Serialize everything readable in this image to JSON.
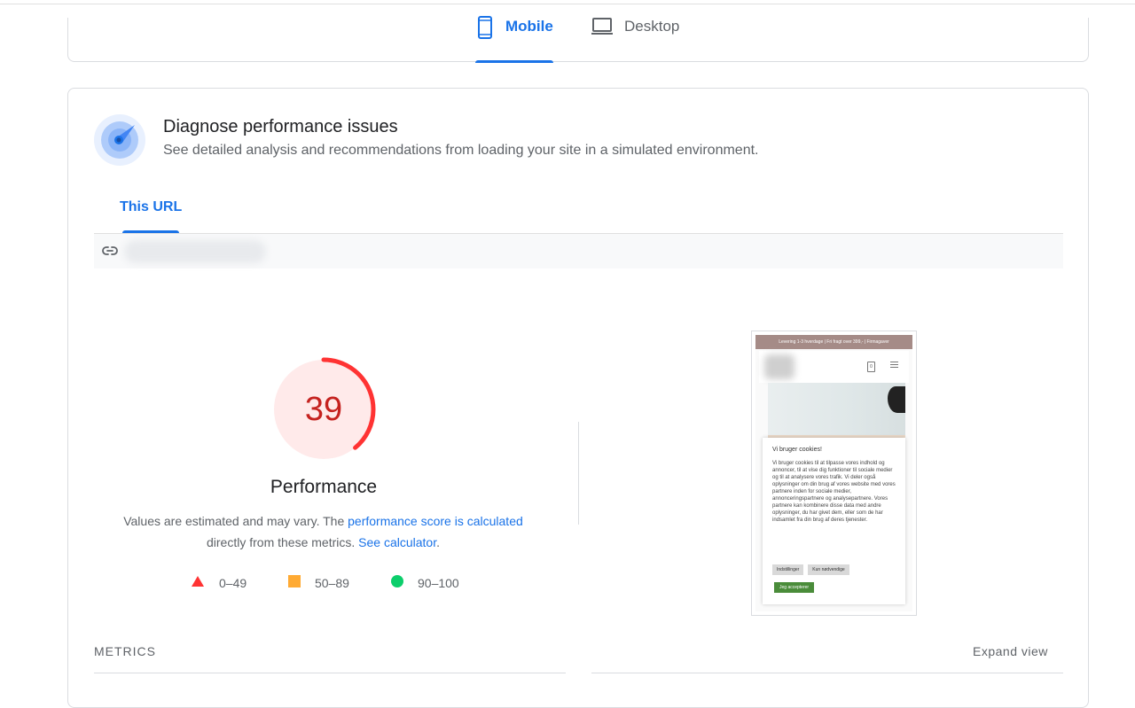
{
  "device_tabs": [
    {
      "label": "Mobile",
      "icon": "smartphone-icon",
      "selected": true
    },
    {
      "label": "Desktop",
      "icon": "laptop-icon",
      "selected": false
    }
  ],
  "diagnose": {
    "title": "Diagnose performance issues",
    "subtitle": "See detailed analysis and recommendations from loading your site in a simulated environment."
  },
  "url_tab": {
    "label": "This URL"
  },
  "score": {
    "value": "39",
    "fraction": 0.39,
    "label": "Performance",
    "desc_before": "Values are estimated and may vary. The ",
    "desc_link1": "performance score is calculated",
    "desc_middle": " directly from these metrics. ",
    "desc_link2": "See calculator",
    "desc_after": "."
  },
  "legend": [
    {
      "range": "0–49",
      "shape": "triangle",
      "color": "#ff3333"
    },
    {
      "range": "50–89",
      "shape": "square",
      "color": "#ffaa33"
    },
    {
      "range": "90–100",
      "shape": "circle",
      "color": "#0cce6b"
    }
  ],
  "screenshot": {
    "banner": "Levering 1-3 hverdage | Fri fragt over 399,- | Firmagaver",
    "bag_count": "0",
    "popup_title": "Vi bruger cookies!",
    "popup_body": "Vi bruger cookies til at tilpasse vores indhold og annoncer, til at vise dig funktioner til sociale medier og til at analysere vores trafik. Vi deler også oplysninger om din brug af vores website med vores partnere inden for sociale medier, annonceringspartnere og analysepartnere. Vores partnere kan kombinere disse data med andre oplysninger, du har givet dem, eller som de har indsamlet fra din brug af deres tjenester.",
    "btn_settings": "Indstillinger",
    "btn_necessary": "Kun nødvendige",
    "btn_accept": "Jeg accepterer"
  },
  "metrics": {
    "label": "METRICS",
    "expand": "Expand view"
  },
  "colors": {
    "accent": "#1a73e8",
    "fail": "#ff3333",
    "fail_text": "#c5221f",
    "fail_bg": "#ffeaea"
  }
}
